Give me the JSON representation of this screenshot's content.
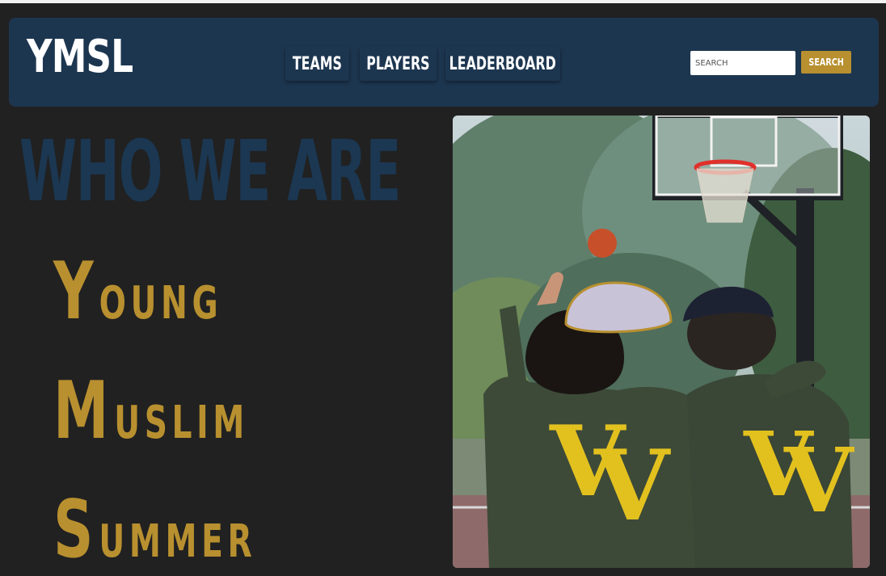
{
  "navbar": {
    "logo": "YMSL",
    "links": [
      "TEAMS",
      "PLAYERS",
      "LEADERBOARD"
    ],
    "search": {
      "placeholder": "SEARCH",
      "button_label": "SEARCH"
    }
  },
  "main": {
    "heading": "WHO WE ARE",
    "acronym": [
      {
        "initial": "Y",
        "rest": "OUNG"
      },
      {
        "initial": "M",
        "rest": "USLIM"
      },
      {
        "initial": "S",
        "rest": "UMMER"
      }
    ],
    "photo": {
      "shirt_letter": "V"
    }
  },
  "colors": {
    "background": "#212121",
    "navbar": "#1d3650",
    "heading": "#1b3752",
    "accent_gold": "#b8902f",
    "shirt": "#3d4a38",
    "shirt_print": "#e2c11f"
  }
}
